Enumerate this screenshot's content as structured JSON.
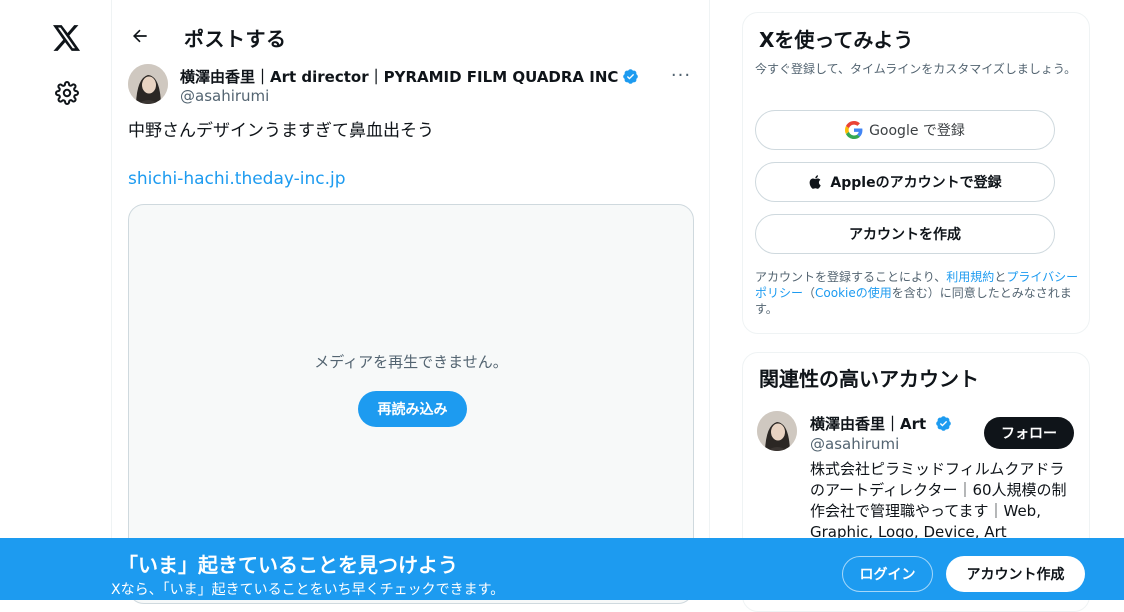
{
  "header": {
    "title": "ポストする"
  },
  "tweet": {
    "author_name": "横澤由香里｜Art director｜PYRAMID FILM QUADRA INC",
    "author_handle": "@asahirumi",
    "more_label": "···",
    "text": "中野さんデザインうますぎて鼻血出そう",
    "link": "shichi-hachi.theday-inc.jp",
    "media_error": "メディアを再生できません。",
    "reload_label": "再読み込み"
  },
  "signup": {
    "title": "Xを使ってみよう",
    "subtitle": "今すぐ登録して、タイムラインをカスタマイズしましょう。",
    "google_label": "Google で登録",
    "apple_label": "Appleのアカウントで登録",
    "create_label": "アカウントを作成",
    "terms_prefix": "アカウントを登録することにより、",
    "terms_link": "利用規約",
    "terms_and": "と",
    "privacy_link": "プライバシーポリシー",
    "terms_paren_open": "（",
    "cookie_link": "Cookieの使用",
    "terms_suffix": "を含む）に同意したとみなされます。"
  },
  "related": {
    "title": "関連性の高いアカウント",
    "name": "横澤由香里｜Art director｜PYRAMID FILM QUADRA INC",
    "handle": "@asahirumi",
    "follow_label": "フォロー",
    "bio": "株式会社ピラミッドフィルムクアドラのアートディレクター｜60人規模の制作会社で管理職やってます｜Web, Graphic, Logo, Device, Art Direction｜"
  },
  "banner": {
    "title": "「いま」起きていることを見つけよう",
    "subtitle": "Xなら、「いま」起きていることをいち早くチェックできます。",
    "login_label": "ログイン",
    "create_label": "アカウント作成"
  },
  "colors": {
    "accent": "#1d9bf0",
    "text": "#0f1419",
    "muted": "#536471",
    "border": "#cfd9de"
  },
  "icons": [
    "x-logo-icon",
    "settings-gear-icon",
    "back-arrow-icon",
    "verified-badge-icon",
    "google-icon",
    "apple-icon"
  ]
}
